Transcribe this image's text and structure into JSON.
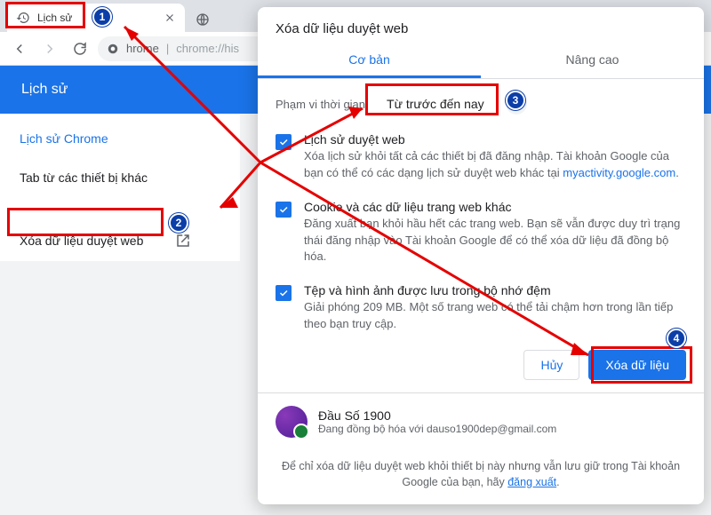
{
  "tab": {
    "title": "Lịch sử"
  },
  "omnibox": {
    "host": "hrome",
    "path": "chrome://his"
  },
  "history": {
    "title": "Lịch sử",
    "items": [
      "Lịch sử Chrome",
      "Tab từ các thiết bị khác"
    ],
    "clear": "Xóa dữ liệu duyệt web"
  },
  "dialog": {
    "title": "Xóa dữ liệu duyệt web",
    "tabs": {
      "basic": "Cơ bản",
      "advanced": "Nâng cao"
    },
    "range_label": "Phạm vi thời gian",
    "range_value": "Từ trước đến nay",
    "options": [
      {
        "title": "Lịch sử duyệt web",
        "desc_pre": "Xóa lịch sử khỏi tất cả các thiết bị đã đăng nhập. Tài khoản Google của bạn có thể có các dạng lịch sử duyệt web khác tại ",
        "link": "myactivity.google.com",
        "desc_post": "."
      },
      {
        "title": "Cookie và các dữ liệu trang web khác",
        "desc": "Đăng xuất bạn khỏi hầu hết các trang web. Bạn sẽ vẫn được duy trì trạng thái đăng nhập vào Tài khoản Google để có thể xóa dữ liệu đã đồng bộ hóa."
      },
      {
        "title": "Tệp và hình ảnh được lưu trong bộ nhớ đệm",
        "desc": "Giải phóng 209 MB. Một số trang web có thể tải chậm hơn trong lần tiếp theo bạn truy cập."
      }
    ],
    "cancel": "Hủy",
    "confirm": "Xóa dữ liệu",
    "sync_name": "Đầu Số 1900",
    "sync_email_pre": "Đang đồng bộ hóa với ",
    "sync_email": "dauso1900dep@gmail.com",
    "foot_pre": "Để chỉ xóa dữ liệu duyệt web khỏi thiết bị này nhưng vẫn lưu giữ trong Tài khoản Google của bạn, hãy ",
    "foot_link": "đăng xuất",
    "foot_post": "."
  },
  "steps": [
    "1",
    "2",
    "3",
    "4"
  ]
}
